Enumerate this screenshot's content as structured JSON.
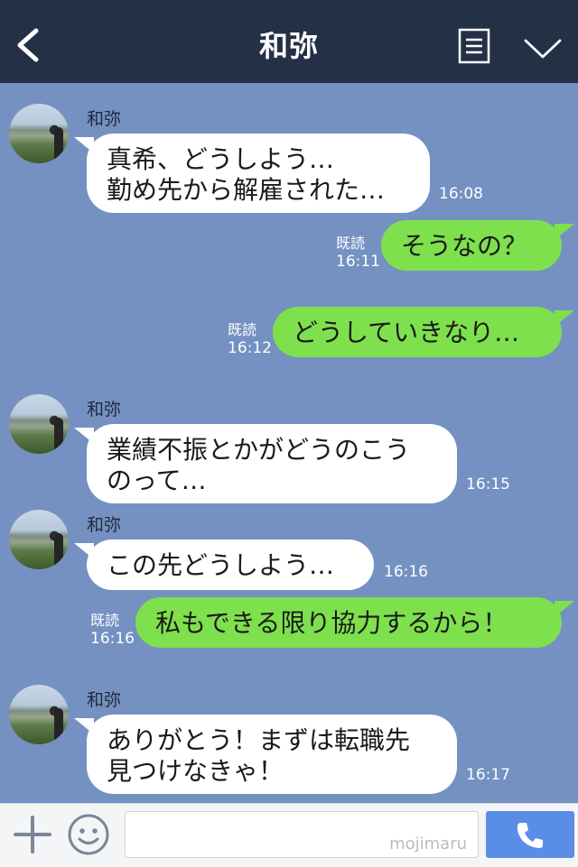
{
  "header": {
    "title": "和弥"
  },
  "messages": {
    "m1": {
      "sender": "和弥",
      "text": "真希、どうしよう…\n勤め先から解雇された…",
      "time": "16:08"
    },
    "m2": {
      "text": "そうなの？",
      "read": "既読",
      "time": "16:11"
    },
    "m3": {
      "text": "どうしていきなり…",
      "read": "既読",
      "time": "16:12"
    },
    "m4": {
      "sender": "和弥",
      "text": "業績不振とかがどうのこう\nのって…",
      "time": "16:15"
    },
    "m5": {
      "sender": "和弥",
      "text": "この先どうしよう…",
      "time": "16:16"
    },
    "m6": {
      "text": "私もできる限り協力するから！",
      "read": "既読",
      "time": "16:16"
    },
    "m7": {
      "sender": "和弥",
      "text": "ありがとう！まずは転職先\n見つけなきゃ！",
      "time": "16:17"
    }
  },
  "input": {
    "watermark": "mojimaru"
  },
  "icons": {
    "back": "back-icon",
    "menu": "menu-icon",
    "collapse": "chevron-down-icon",
    "plus": "plus-icon",
    "emoji": "smile-icon",
    "call": "phone-icon"
  },
  "colors": {
    "header": "#243045",
    "background": "#7491c2",
    "incoming_bubble": "#ffffff",
    "outgoing_bubble": "#7ee04d",
    "call_button": "#5a8ee6"
  }
}
